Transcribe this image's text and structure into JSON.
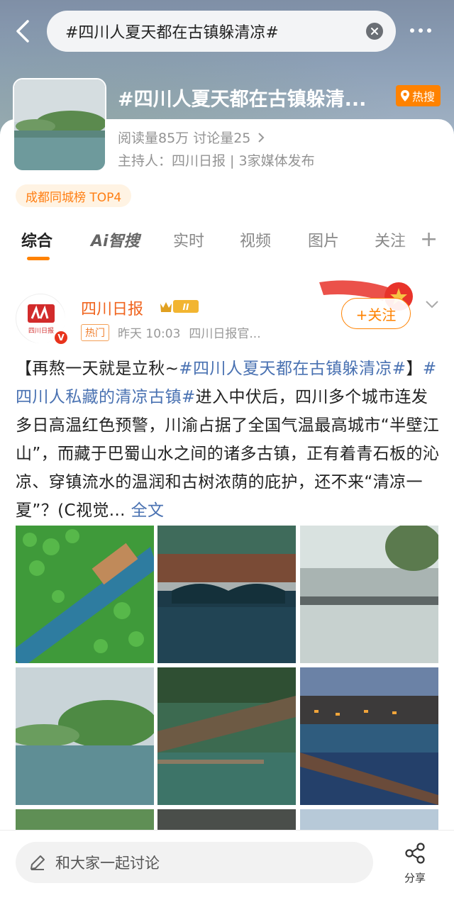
{
  "search": {
    "query": "#四川人夏天都在古镇躲清凉#"
  },
  "topic": {
    "title": "#四川人夏天都在古镇躲清...",
    "hot_badge": "热搜",
    "stats": "阅读量85万  讨论量25",
    "host": "主持人：四川日报 | 3家媒体发布",
    "rank_tag": "成都同城榜 TOP4"
  },
  "tabs": [
    "综合",
    "Ai智搜",
    "实时",
    "视频",
    "图片",
    "关注"
  ],
  "post": {
    "author": "四川日报",
    "level_badge": "II",
    "hot_tag": "热门",
    "time": "昨天 10:03",
    "source": "四川日报官...",
    "follow_label": "+关注",
    "avatar_text": "四川日报",
    "text_prefix": "【再熬一天就是立秋~",
    "tag1": "#四川人夏天都在古镇躲清凉#",
    "text_mid": "】",
    "tag2": "#四川人私藏的清凉古镇#",
    "text_body": "进入中伏后，四川多个城市连发多日高温红色预警，川渝占据了全国气温最高城市“半壁江山”，而藏于巴蜀山水之间的诸多古镇，正有着青石板的沁凉、穿镇流水的温润和古树浓荫的庇护，还不来“清凉一夏”？(C视觉...",
    "full_text_link": "全文"
  },
  "bottom": {
    "comment_placeholder": "和大家一起讨论",
    "share_label": "分享"
  }
}
